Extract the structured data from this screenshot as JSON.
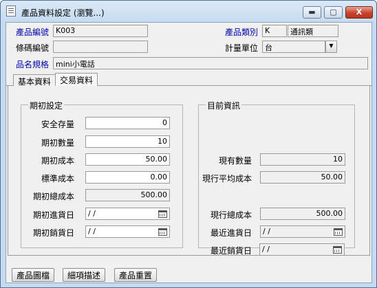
{
  "window": {
    "title": "產品資料設定 (瀏覽...)",
    "controls": {
      "minimize": "▬",
      "maximize": "▢",
      "close": "X"
    }
  },
  "header": {
    "product_id_label": "產品編號",
    "product_id_value": "K003",
    "barcode_label": "條碼編號",
    "barcode_value": "",
    "product_spec_label": "品名規格",
    "product_spec_value": "mini小電話",
    "category_label": "產品類別",
    "category_code": "K",
    "category_name": "通訊類",
    "unit_label": "計量單位",
    "unit_value": "台",
    "unit_arrow": "▼"
  },
  "tabs": [
    {
      "label": "基本資料",
      "active": false
    },
    {
      "label": "交易資料",
      "active": true
    }
  ],
  "initial_settings": {
    "title": "期初設定",
    "safety_stock_label": "安全存量",
    "safety_stock_value": "0",
    "initial_qty_label": "期初數量",
    "initial_qty_value": "10",
    "initial_cost_label": "期初成本",
    "initial_cost_value": "50.00",
    "standard_cost_label": "標準成本",
    "standard_cost_value": "0.00",
    "initial_total_cost_label": "期初總成本",
    "initial_total_cost_value": "500.00",
    "initial_purchase_date_label": "期初進貨日",
    "initial_purchase_date_value": "/ /",
    "initial_sale_date_label": "期初銷貨日",
    "initial_sale_date_value": "/ /"
  },
  "current_info": {
    "title": "目前資訊",
    "current_qty_label": "現有數量",
    "current_qty_value": "10",
    "avg_cost_label": "現行平均成本",
    "avg_cost_value": "50.00",
    "total_cost_label": "現行總成本",
    "total_cost_value": "500.00",
    "last_purchase_date_label": "最近進貨日",
    "last_purchase_date_value": "/ /",
    "last_sale_date_label": "最近銷貨日",
    "last_sale_date_value": "/ /"
  },
  "bottom_buttons": {
    "product_image": "產品圖檔",
    "item_description": "細項描述",
    "product_reset": "產品重置"
  },
  "colors": {
    "label_blue": "#0000b0",
    "field_grey": "#f0f0f0",
    "title_bar": "#c6dbf1",
    "close_red": "#c9442c"
  }
}
